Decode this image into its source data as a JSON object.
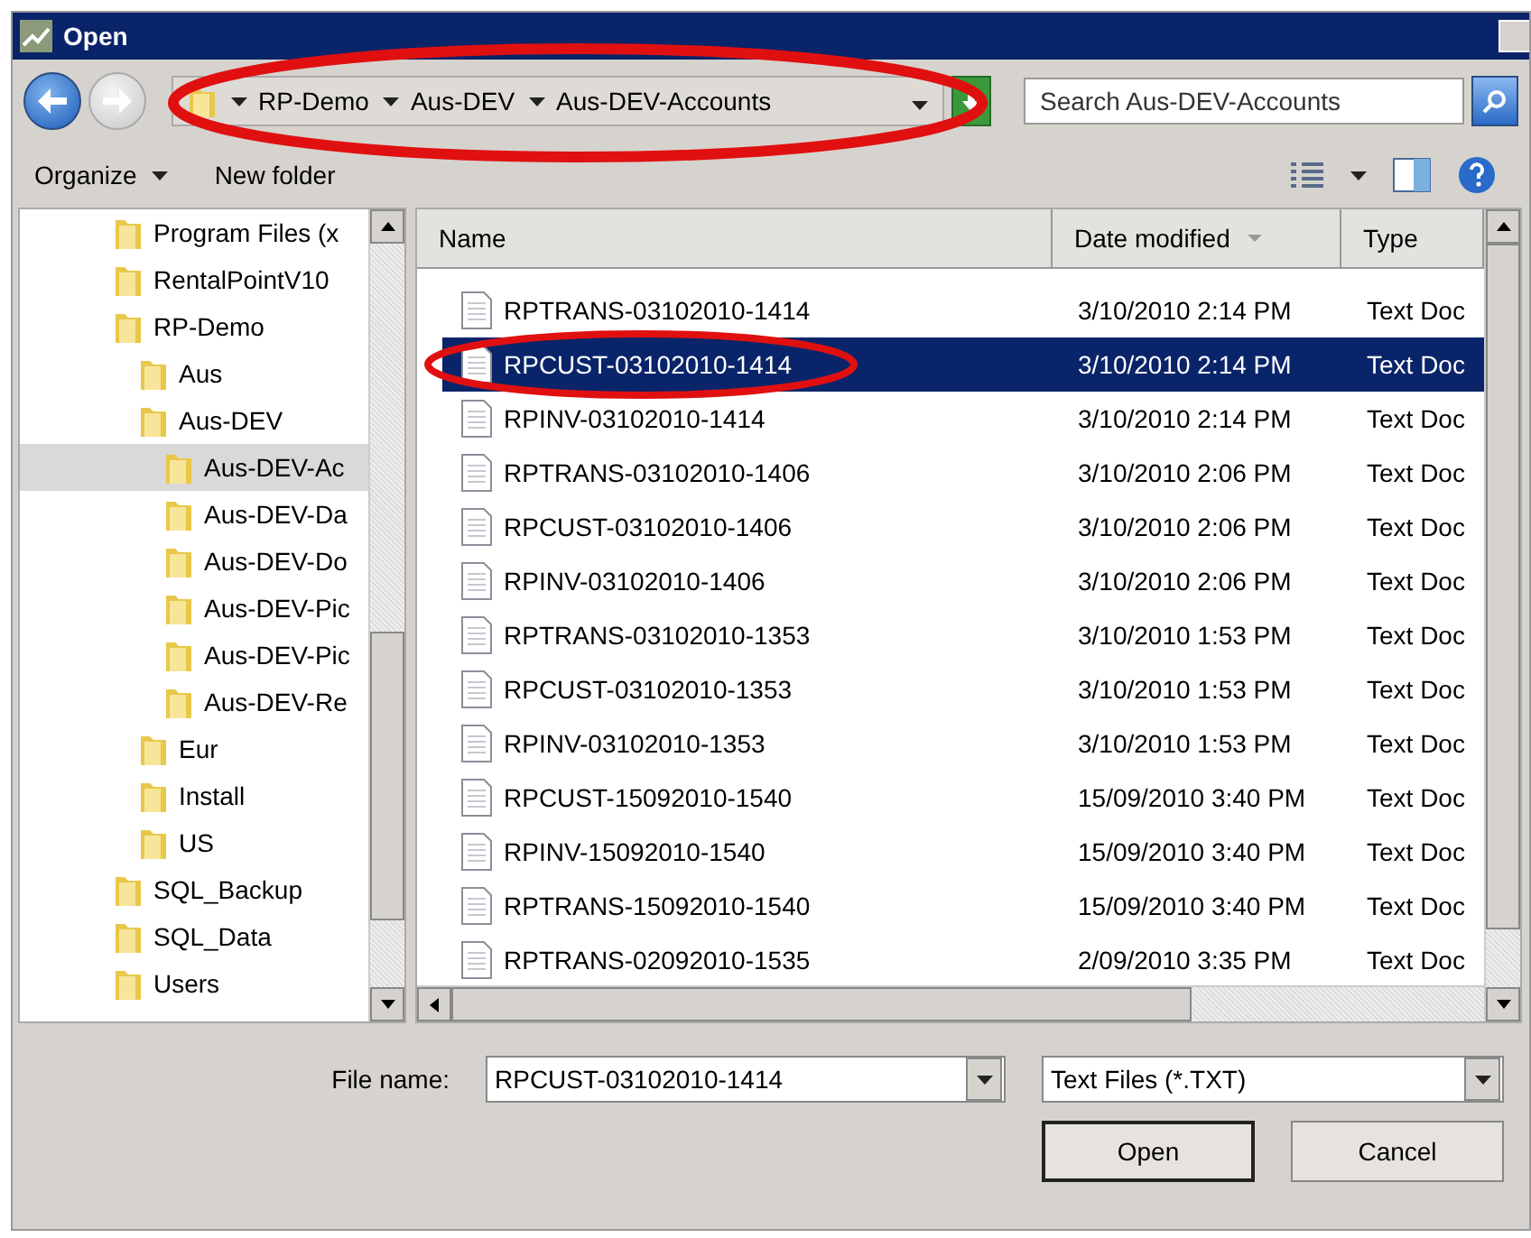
{
  "window": {
    "title": "Open"
  },
  "address": {
    "segments": [
      "RP-Demo",
      "Aus-DEV",
      "Aus-DEV-Accounts"
    ]
  },
  "search": {
    "placeholder": "Search Aus-DEV-Accounts"
  },
  "toolbar": {
    "buttons": [
      {
        "label": "Organize",
        "dropdown": true
      },
      {
        "label": "New folder",
        "dropdown": false
      }
    ]
  },
  "tree": {
    "items": [
      {
        "label": "Program Files (x",
        "selected": false
      },
      {
        "label": "RentalPointV10",
        "selected": false
      },
      {
        "label": "RP-Demo",
        "selected": false,
        "children": [
          {
            "label": "Aus",
            "selected": false
          },
          {
            "label": "Aus-DEV",
            "selected": false,
            "children": [
              {
                "label": "Aus-DEV-Ac",
                "selected": true
              },
              {
                "label": "Aus-DEV-Da",
                "selected": false
              },
              {
                "label": "Aus-DEV-Do",
                "selected": false
              },
              {
                "label": "Aus-DEV-Pic",
                "selected": false
              },
              {
                "label": "Aus-DEV-Pic",
                "selected": false
              },
              {
                "label": "Aus-DEV-Re",
                "selected": false
              }
            ]
          },
          {
            "label": "Eur",
            "selected": false
          },
          {
            "label": "Install",
            "selected": false
          },
          {
            "label": "US",
            "selected": false
          }
        ]
      },
      {
        "label": "SQL_Backup",
        "selected": false
      },
      {
        "label": "SQL_Data",
        "selected": false
      },
      {
        "label": "Users",
        "selected": false
      }
    ]
  },
  "files": {
    "columns": [
      {
        "label": "Name",
        "sorted": false
      },
      {
        "label": "Date modified",
        "sorted": true
      },
      {
        "label": "Type",
        "sorted": false
      }
    ],
    "rows": [
      {
        "name": "RPTRANS-03102010-1414",
        "date": "3/10/2010 2:14 PM",
        "type": "Text Doc",
        "selected": false
      },
      {
        "name": "RPCUST-03102010-1414",
        "date": "3/10/2010 2:14 PM",
        "type": "Text Doc",
        "selected": true
      },
      {
        "name": "RPINV-03102010-1414",
        "date": "3/10/2010 2:14 PM",
        "type": "Text Doc",
        "selected": false
      },
      {
        "name": "RPTRANS-03102010-1406",
        "date": "3/10/2010 2:06 PM",
        "type": "Text Doc",
        "selected": false
      },
      {
        "name": "RPCUST-03102010-1406",
        "date": "3/10/2010 2:06 PM",
        "type": "Text Doc",
        "selected": false
      },
      {
        "name": "RPINV-03102010-1406",
        "date": "3/10/2010 2:06 PM",
        "type": "Text Doc",
        "selected": false
      },
      {
        "name": "RPTRANS-03102010-1353",
        "date": "3/10/2010 1:53 PM",
        "type": "Text Doc",
        "selected": false
      },
      {
        "name": "RPCUST-03102010-1353",
        "date": "3/10/2010 1:53 PM",
        "type": "Text Doc",
        "selected": false
      },
      {
        "name": "RPINV-03102010-1353",
        "date": "3/10/2010 1:53 PM",
        "type": "Text Doc",
        "selected": false
      },
      {
        "name": "RPCUST-15092010-1540",
        "date": "15/09/2010 3:40 PM",
        "type": "Text Doc",
        "selected": false
      },
      {
        "name": "RPINV-15092010-1540",
        "date": "15/09/2010 3:40 PM",
        "type": "Text Doc",
        "selected": false
      },
      {
        "name": "RPTRANS-15092010-1540",
        "date": "15/09/2010 3:40 PM",
        "type": "Text Doc",
        "selected": false
      },
      {
        "name": "RPTRANS-02092010-1535",
        "date": "2/09/2010 3:35 PM",
        "type": "Text Doc",
        "selected": false
      }
    ]
  },
  "file_name": {
    "label": "File name:",
    "value": "RPCUST-03102010-1414"
  },
  "file_type": {
    "value": "Text Files (*.TXT)"
  },
  "buttons": [
    {
      "label": "Open",
      "default": true
    },
    {
      "label": "Cancel",
      "default": false
    }
  ]
}
